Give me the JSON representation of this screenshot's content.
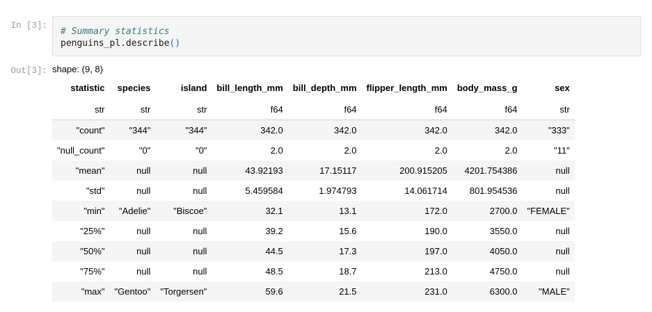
{
  "cell": {
    "in_prompt": "In [3]:",
    "out_prompt": "Out[3]:",
    "code_comment": "# Summary statistics",
    "code_call": "penguins_pl.describe",
    "code_parens": "()"
  },
  "output": {
    "shape": "shape: (9, 8)",
    "columns": [
      "statistic",
      "species",
      "island",
      "bill_length_mm",
      "bill_depth_mm",
      "flipper_length_mm",
      "body_mass_g",
      "sex"
    ],
    "dtypes": [
      "str",
      "str",
      "str",
      "f64",
      "f64",
      "f64",
      "f64",
      "str"
    ],
    "rows": [
      [
        "\"count\"",
        "\"344\"",
        "\"344\"",
        "342.0",
        "342.0",
        "342.0",
        "342.0",
        "\"333\""
      ],
      [
        "\"null_count\"",
        "\"0\"",
        "\"0\"",
        "2.0",
        "2.0",
        "2.0",
        "2.0",
        "\"11\""
      ],
      [
        "\"mean\"",
        "null",
        "null",
        "43.92193",
        "17.15117",
        "200.915205",
        "4201.754386",
        "null"
      ],
      [
        "\"std\"",
        "null",
        "null",
        "5.459584",
        "1.974793",
        "14.061714",
        "801.954536",
        "null"
      ],
      [
        "\"min\"",
        "\"Adelie\"",
        "\"Biscoe\"",
        "32.1",
        "13.1",
        "172.0",
        "2700.0",
        "\"FEMALE\""
      ],
      [
        "\"25%\"",
        "null",
        "null",
        "39.2",
        "15.6",
        "190.0",
        "3550.0",
        "null"
      ],
      [
        "\"50%\"",
        "null",
        "null",
        "44.5",
        "17.3",
        "197.0",
        "4050.0",
        "null"
      ],
      [
        "\"75%\"",
        "null",
        "null",
        "48.5",
        "18.7",
        "213.0",
        "4750.0",
        "null"
      ],
      [
        "\"max\"",
        "\"Gentoo\"",
        "\"Torgersen\"",
        "59.6",
        "21.5",
        "231.0",
        "6300.0",
        "\"MALE\""
      ]
    ]
  }
}
